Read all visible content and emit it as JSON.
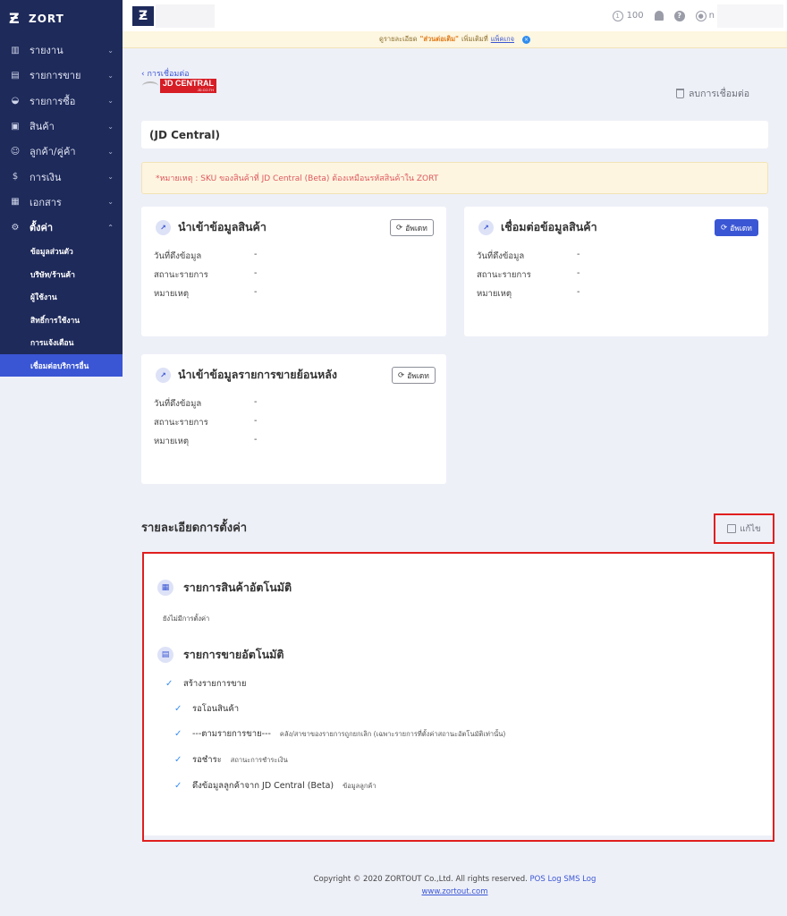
{
  "app": {
    "brand": "ZORT",
    "credits": "100",
    "user_initial": "n"
  },
  "sidebar": {
    "items": [
      {
        "label": "รายงาน",
        "icon": "bar-chart-icon"
      },
      {
        "label": "รายการขาย",
        "icon": "clipboard-icon"
      },
      {
        "label": "รายการซื้อ",
        "icon": "basket-icon"
      },
      {
        "label": "สินค้า",
        "icon": "box-icon"
      },
      {
        "label": "ลูกค้า/คู่ค้า",
        "icon": "people-icon"
      },
      {
        "label": "การเงิน",
        "icon": "money-icon"
      },
      {
        "label": "เอกสาร",
        "icon": "document-icon"
      },
      {
        "label": "ตั้งค่า",
        "icon": "gear-icon"
      }
    ],
    "sub_items": [
      "ข้อมูลส่วนตัว",
      "บริษัท/ร้านค้า",
      "ผู้ใช้งาน",
      "สิทธิ์การใช้งาน",
      "การแจ้งเตือน",
      "เชื่อมต่อบริการอื่น"
    ]
  },
  "notice": {
    "prefix": "ดูรายละเอียด",
    "highlight": "\"ส่วนต่อเติม\"",
    "middle": "เพิ่มเติมที่",
    "link": "แพ็คเกจ",
    "close": "×"
  },
  "header": {
    "back_label": "การเชื่อมต่อ",
    "logo_text": "JD CENTRAL",
    "logo_sub": "JD.CO.TH",
    "unlink_label": "ลบการเชื่อมต่อ"
  },
  "connection_name": "(JD Central)",
  "warning": "*หมายเหตุ : SKU ของสินค้าที่ JD Central (Beta) ต้องเหมือนรหัสสินค้าใน ZORT",
  "row_labels": {
    "pulled": "วันที่ดึงข้อมูล",
    "status": "สถานะรายการ",
    "note": "หมายเหตุ",
    "empty": "-"
  },
  "cards": {
    "import_products": {
      "title": "นำเข้าข้อมูลสินค้า",
      "button": "อัพเดท"
    },
    "link_products": {
      "title": "เชื่อมต่อข้อมูลสินค้า",
      "button": "อัพเดท"
    },
    "import_orders": {
      "title": "นำเข้าข้อมูลรายการขายย้อนหลัง",
      "button": "อัพเดท"
    }
  },
  "settings": {
    "title": "รายละเอียดการตั้งค่า",
    "edit_label": "แก้ไข",
    "auto_products": {
      "title": "รายการสินค้าอัตโนมัติ",
      "note": "ยังไม่มีการตั้งค่า"
    },
    "auto_orders": {
      "title": "รายการขายอัตโนมัติ",
      "items": [
        {
          "label": "สร้างรายการขาย",
          "detail": ""
        },
        {
          "label": "รอโอนสินค้า",
          "detail": ""
        },
        {
          "label": "---ตามรายการขาย---",
          "detail": "คลัง/สาขาของรายการถูกยกเลิก (เฉพาะรายการที่ตั้งค่าสถานะอัตโนมัติเท่านั้น)"
        },
        {
          "label": "รอชำระ",
          "detail": "สถานะการชำระเงิน"
        },
        {
          "label": "ดึงข้อมูลลูกค้าจาก JD Central (Beta)",
          "detail": "ข้อมูลลูกค้า"
        }
      ]
    }
  },
  "footer": {
    "copyright": "Copyright © 2020 ZORTOUT Co.,Ltd. All rights reserved.",
    "links": [
      "POS",
      "Log",
      "SMS Log"
    ],
    "site": "www.zortout.com"
  }
}
